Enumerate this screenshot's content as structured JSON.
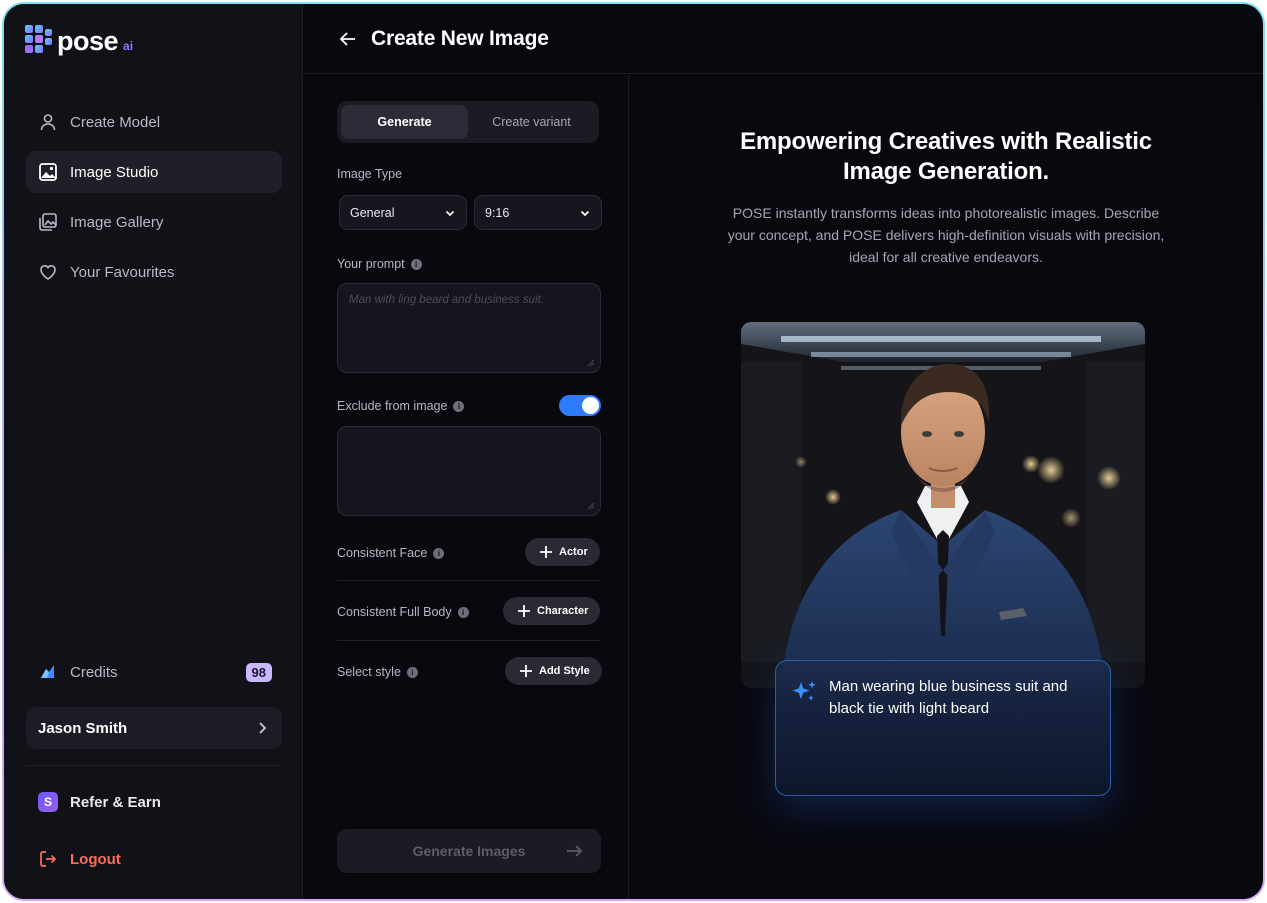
{
  "brand": {
    "name": "pose",
    "suffix": "ai"
  },
  "sidebar": {
    "items": [
      {
        "label": "Create Model",
        "icon": "user-icon"
      },
      {
        "label": "Image Studio",
        "icon": "image-icon"
      },
      {
        "label": "Image Gallery",
        "icon": "gallery-icon"
      },
      {
        "label": "Your Favourites",
        "icon": "heart-icon"
      }
    ],
    "credits_label": "Credits",
    "credits_count": "98",
    "user_name": "Jason Smith",
    "refer_badge": "S",
    "refer_label": "Refer & Earn",
    "logout_label": "Logout"
  },
  "header": {
    "title": "Create New Image"
  },
  "form": {
    "tabs": [
      "Generate",
      "Create variant"
    ],
    "image_type_label": "Image Type",
    "image_type_value": "General",
    "ratio_value": "9:16",
    "prompt_label": "Your prompt",
    "prompt_placeholder": "Man with ling beard and business suit.",
    "exclude_label": "Exclude from image",
    "exclude_enabled": true,
    "face_label": "Consistent Face",
    "face_button": "Actor",
    "body_label": "Consistent Full Body",
    "body_button": "Character",
    "style_label": "Select style",
    "style_button": "Add Style",
    "generate_button": "Generate Images"
  },
  "preview": {
    "title_line1": "Empowering Creatives with Realistic",
    "title_line2": "Image Generation.",
    "subtitle_line1": "POSE instantly transforms ideas into photorealistic images. Describe",
    "subtitle_line2": "your concept, and POSE delivers high-definition visuals with precision,",
    "subtitle_line3": "ideal for all creative endeavors.",
    "caption": "Man wearing blue business suit and black tie with light beard"
  },
  "colors": {
    "accent": "#2f7bff",
    "logout": "#ff6b55",
    "credits_badge": "#c9b8ff"
  }
}
